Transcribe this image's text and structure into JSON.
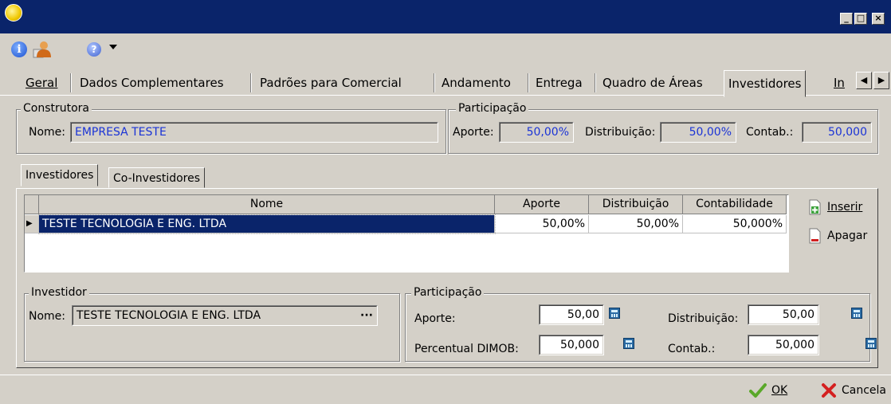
{
  "window": {
    "min_label": "_",
    "max_label": "□",
    "close_label": "×"
  },
  "tabs": [
    {
      "label": "Geral"
    },
    {
      "label": "Dados Complementares"
    },
    {
      "label": "Padrões para Comercial"
    },
    {
      "label": "Andamento"
    },
    {
      "label": "Entrega"
    },
    {
      "label": "Quadro de Áreas"
    },
    {
      "label": "Investidores"
    },
    {
      "label": "In"
    }
  ],
  "construtora": {
    "legend": "Construtora",
    "nome_label": "Nome:",
    "nome_value": "EMPRESA TESTE"
  },
  "participacao_top": {
    "legend": "Participação",
    "aporte_label": "Aporte:",
    "aporte_value": "50,00%",
    "distribuicao_label": "Distribuição:",
    "distribuicao_value": "50,00%",
    "contab_label": "Contab.:",
    "contab_value": "50,000"
  },
  "inner_tabs": [
    {
      "label": "Investidores"
    },
    {
      "label": "Co-Investidores"
    }
  ],
  "grid": {
    "columns": [
      "Nome",
      "Aporte",
      "Distribuição",
      "Contabilidade"
    ],
    "rows": [
      {
        "nome": "TESTE TECNOLOGIA E ENG. LTDA",
        "aporte": "50,00%",
        "distribuicao": "50,00%",
        "contabilidade": "50,000%"
      }
    ]
  },
  "actions": {
    "inserir": "Inserir",
    "apagar": "Apagar"
  },
  "investidor": {
    "legend": "Investidor",
    "nome_label": "Nome:",
    "nome_value": "TESTE TECNOLOGIA E ENG. LTDA",
    "ellipsis": "···"
  },
  "participacao_bottom": {
    "legend": "Participação",
    "aporte_label": "Aporte:",
    "aporte_value": "50,00",
    "dimob_label": "Percentual DIMOB:",
    "dimob_value": "50,000",
    "distribuicao_label": "Distribuição:",
    "distribuicao_value": "50,00",
    "contab_label": "Contab.:",
    "contab_value": "50,000"
  },
  "footer": {
    "ok_label": "OK",
    "cancel_label": "Cancela"
  },
  "colors": {
    "titlebar": "#0a246a",
    "face": "#d4d0c8",
    "link_text": "#1a33d6",
    "selection": "#0a246a"
  }
}
